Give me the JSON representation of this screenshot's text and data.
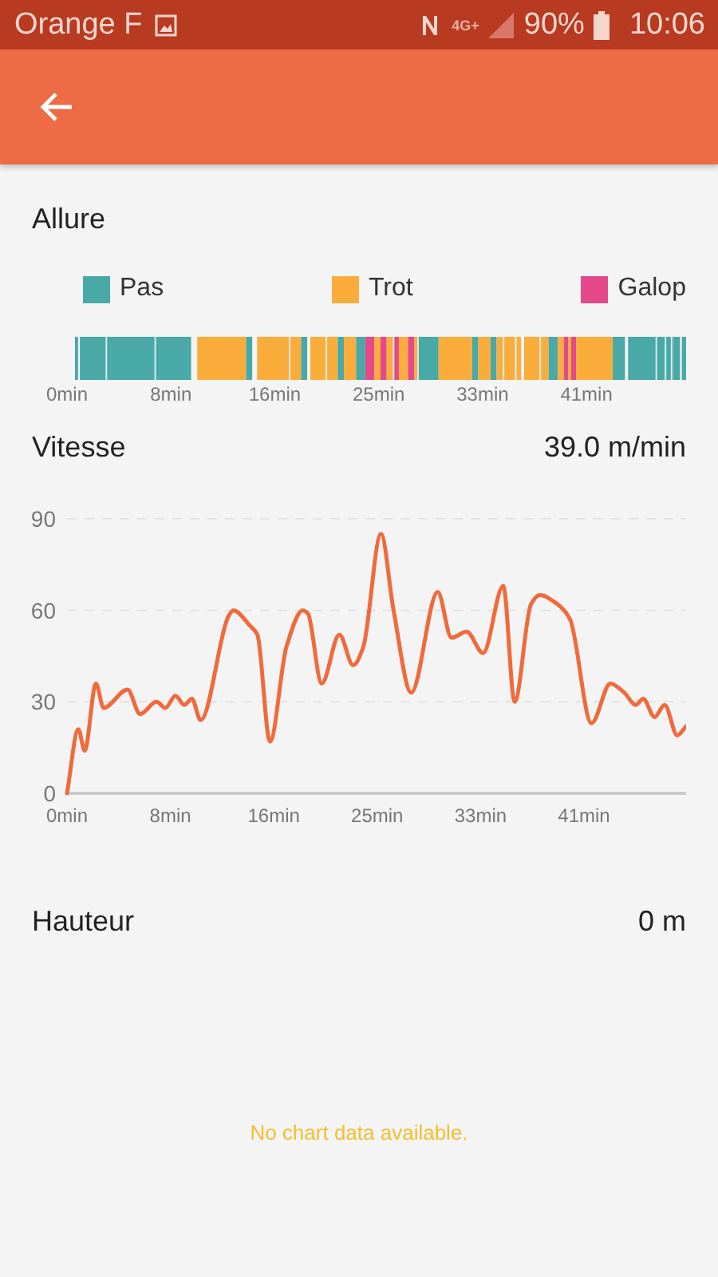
{
  "status_bar": {
    "carrier": "Orange F",
    "network": "4G+",
    "battery": "90%",
    "time": "10:06"
  },
  "gait": {
    "title": "Allure",
    "legend": [
      {
        "label": "Pas",
        "color": "#48a9a6"
      },
      {
        "label": "Trot",
        "color": "#fbad3b"
      },
      {
        "label": "Galop",
        "color": "#e5498a"
      }
    ],
    "ticks": [
      "0min",
      "8min",
      "16min",
      "25min",
      "33min",
      "41min"
    ]
  },
  "speed": {
    "title": "Vitesse",
    "value": "39.0 m/min",
    "chart_data": {
      "type": "line",
      "x": [
        0,
        0.9,
        1.4,
        2.3,
        2.9,
        4.8,
        5.8,
        7.1,
        7.8,
        8.6,
        9.3,
        9.9,
        10.6,
        12.8,
        13.2,
        14.5,
        15.1,
        16.1,
        17.4,
        18.7,
        19.1,
        20.2,
        21.6,
        22.7,
        23.5,
        24.9,
        25.9,
        27.3,
        29.4,
        30.5,
        31.7,
        33.0,
        34.6,
        35.5,
        36.8,
        37.5,
        38.9,
        39.9,
        41.6,
        43.1,
        44.2,
        45.1,
        45.7,
        46.6,
        47.4,
        48.4,
        49.1
      ],
      "series": [
        {
          "color": "#f06a3c",
          "values": [
            0,
            21,
            14,
            36,
            28,
            34,
            26,
            30,
            28,
            32,
            29,
            31,
            24,
            58,
            60,
            55,
            52,
            17,
            48,
            60,
            59,
            36,
            52,
            42,
            48,
            85,
            60,
            33,
            66,
            51,
            53,
            46,
            68,
            30,
            62,
            65,
            62,
            57,
            23,
            36,
            33,
            29,
            31,
            25,
            29,
            19,
            22
          ]
        }
      ],
      "xlim": [
        0,
        49.1
      ],
      "ylim": [
        0,
        90
      ],
      "yticks": [
        0,
        30,
        60,
        90
      ],
      "xticks": [
        {
          "value": 0,
          "label": "0min"
        },
        {
          "value": 8.2,
          "label": "8min"
        },
        {
          "value": 16.4,
          "label": "16min"
        },
        {
          "value": 24.6,
          "label": "25min"
        },
        {
          "value": 32.8,
          "label": "33min"
        },
        {
          "value": 41,
          "label": "41min"
        }
      ]
    }
  },
  "height": {
    "title": "Hauteur",
    "value": "0 m",
    "empty_message": "No chart data available."
  }
}
